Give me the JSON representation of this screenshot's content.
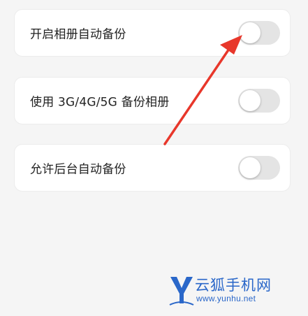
{
  "settings": [
    {
      "label": "开启相册自动备份",
      "enabled": false
    },
    {
      "label": "使用 3G/4G/5G 备份相册",
      "enabled": false
    },
    {
      "label": "允许后台自动备份",
      "enabled": false
    }
  ],
  "annotation": {
    "color": "#e8372b",
    "icon": "red-arrow"
  },
  "watermark": {
    "logo_text": "Y",
    "title": "云狐手机网",
    "url": "www.yunhu.net",
    "color": "#2a67c9"
  },
  "colors": {
    "background": "#f5f5f5",
    "card": "#ffffff",
    "toggle_off": "#e4e4e4",
    "text": "#222222"
  }
}
